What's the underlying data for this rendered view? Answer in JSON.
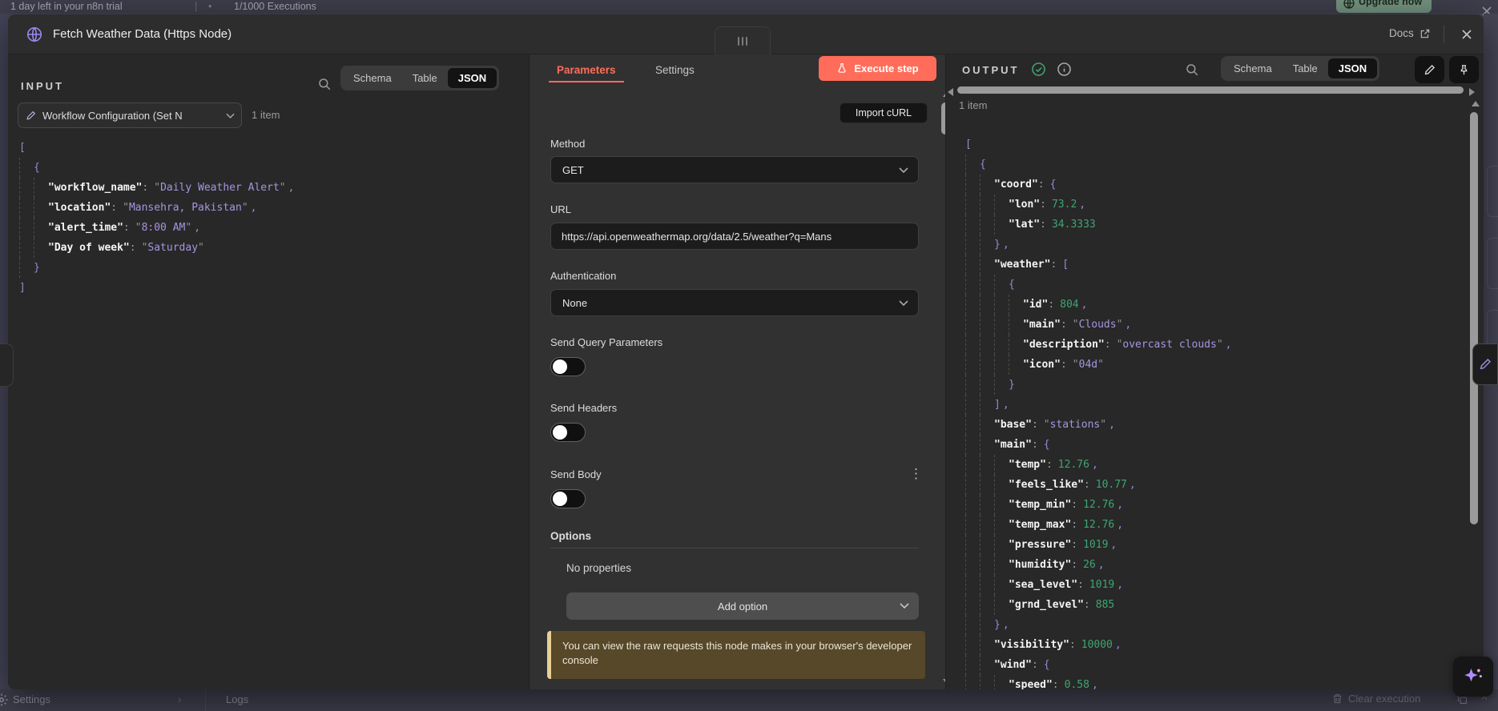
{
  "banner": {
    "trial_text": "1 day left in your n8n trial",
    "separator": "|",
    "executions": "1/1000 Executions",
    "upgrade_label": "Upgrade now"
  },
  "modal_header": {
    "title": "Fetch Weather Data (Https Node)",
    "docs_label": "Docs"
  },
  "input_panel": {
    "title": "INPUT",
    "tabs": [
      "Schema",
      "Table",
      "JSON"
    ],
    "active_tab": "JSON",
    "source_selector": "Workflow Configuration (Set N",
    "items_count": "1 item",
    "code_lines": [
      [
        0,
        null,
        "b",
        "[",
        0
      ],
      [
        1,
        null,
        "b",
        "{",
        0
      ],
      [
        2,
        "workflow_name",
        "s",
        "Daily Weather Alert",
        1
      ],
      [
        2,
        "location",
        "s",
        "Mansehra, Pakistan",
        1
      ],
      [
        2,
        "alert_time",
        "s",
        "8:00 AM",
        1
      ],
      [
        2,
        "Day of week",
        "s",
        "Saturday",
        0
      ],
      [
        1,
        null,
        "b",
        "}",
        0
      ],
      [
        0,
        null,
        "b",
        "]",
        0
      ]
    ]
  },
  "params_panel": {
    "tabs": [
      "Parameters",
      "Settings"
    ],
    "active_tab": "Parameters",
    "execute_label": "Execute step",
    "import_curl_label": "Import cURL",
    "method_label": "Method",
    "method_value": "GET",
    "url_label": "URL",
    "url_value": "https://api.openweathermap.org/data/2.5/weather?q=Mans",
    "auth_label": "Authentication",
    "auth_value": "None",
    "send_query_label": "Send Query Parameters",
    "send_query_on": false,
    "send_headers_label": "Send Headers",
    "send_headers_on": false,
    "send_body_label": "Send Body",
    "send_body_on": false,
    "options_label": "Options",
    "no_properties": "No properties",
    "add_option_label": "Add option",
    "notice_text": "You can view the raw requests this node makes in your browser's developer console"
  },
  "output_panel": {
    "title": "OUTPUT",
    "items_count": "1 item",
    "tabs": [
      "Schema",
      "Table",
      "JSON"
    ],
    "active_tab": "JSON",
    "code_lines": [
      [
        0,
        null,
        "b",
        "[",
        0
      ],
      [
        1,
        null,
        "b",
        "{",
        0
      ],
      [
        2,
        "coord",
        "b",
        "{",
        0
      ],
      [
        3,
        "lon",
        "n",
        "73.2",
        1
      ],
      [
        3,
        "lat",
        "n",
        "34.3333",
        0
      ],
      [
        2,
        null,
        "b",
        "}",
        1
      ],
      [
        2,
        "weather",
        "b",
        "[",
        0
      ],
      [
        3,
        null,
        "b",
        "{",
        0
      ],
      [
        4,
        "id",
        "n",
        "804",
        1
      ],
      [
        4,
        "main",
        "s",
        "Clouds",
        1
      ],
      [
        4,
        "description",
        "s",
        "overcast clouds",
        1
      ],
      [
        4,
        "icon",
        "s",
        "04d",
        0
      ],
      [
        3,
        null,
        "b",
        "}",
        0
      ],
      [
        2,
        null,
        "b",
        "]",
        1
      ],
      [
        2,
        "base",
        "s",
        "stations",
        1
      ],
      [
        2,
        "main",
        "b",
        "{",
        0
      ],
      [
        3,
        "temp",
        "n",
        "12.76",
        1
      ],
      [
        3,
        "feels_like",
        "n",
        "10.77",
        1
      ],
      [
        3,
        "temp_min",
        "n",
        "12.76",
        1
      ],
      [
        3,
        "temp_max",
        "n",
        "12.76",
        1
      ],
      [
        3,
        "pressure",
        "n",
        "1019",
        1
      ],
      [
        3,
        "humidity",
        "n",
        "26",
        1
      ],
      [
        3,
        "sea_level",
        "n",
        "1019",
        1
      ],
      [
        3,
        "grnd_level",
        "n",
        "885",
        0
      ],
      [
        2,
        null,
        "b",
        "}",
        1
      ],
      [
        2,
        "visibility",
        "n",
        "10000",
        1
      ],
      [
        2,
        "wind",
        "b",
        "{",
        0
      ],
      [
        3,
        "speed",
        "n",
        "0.58",
        1
      ]
    ]
  },
  "footer": {
    "settings_label": "Settings",
    "logs_label": "Logs",
    "clear_label": "Clear execution"
  },
  "colors": {
    "accent": "#ff6d5a",
    "json_string": "#a794e0",
    "json_number": "#3fa573",
    "json_bracket": "#9489d4",
    "notice_bg": "#564828",
    "notice_border": "#e9cf97",
    "success_green": "#46a06c"
  }
}
